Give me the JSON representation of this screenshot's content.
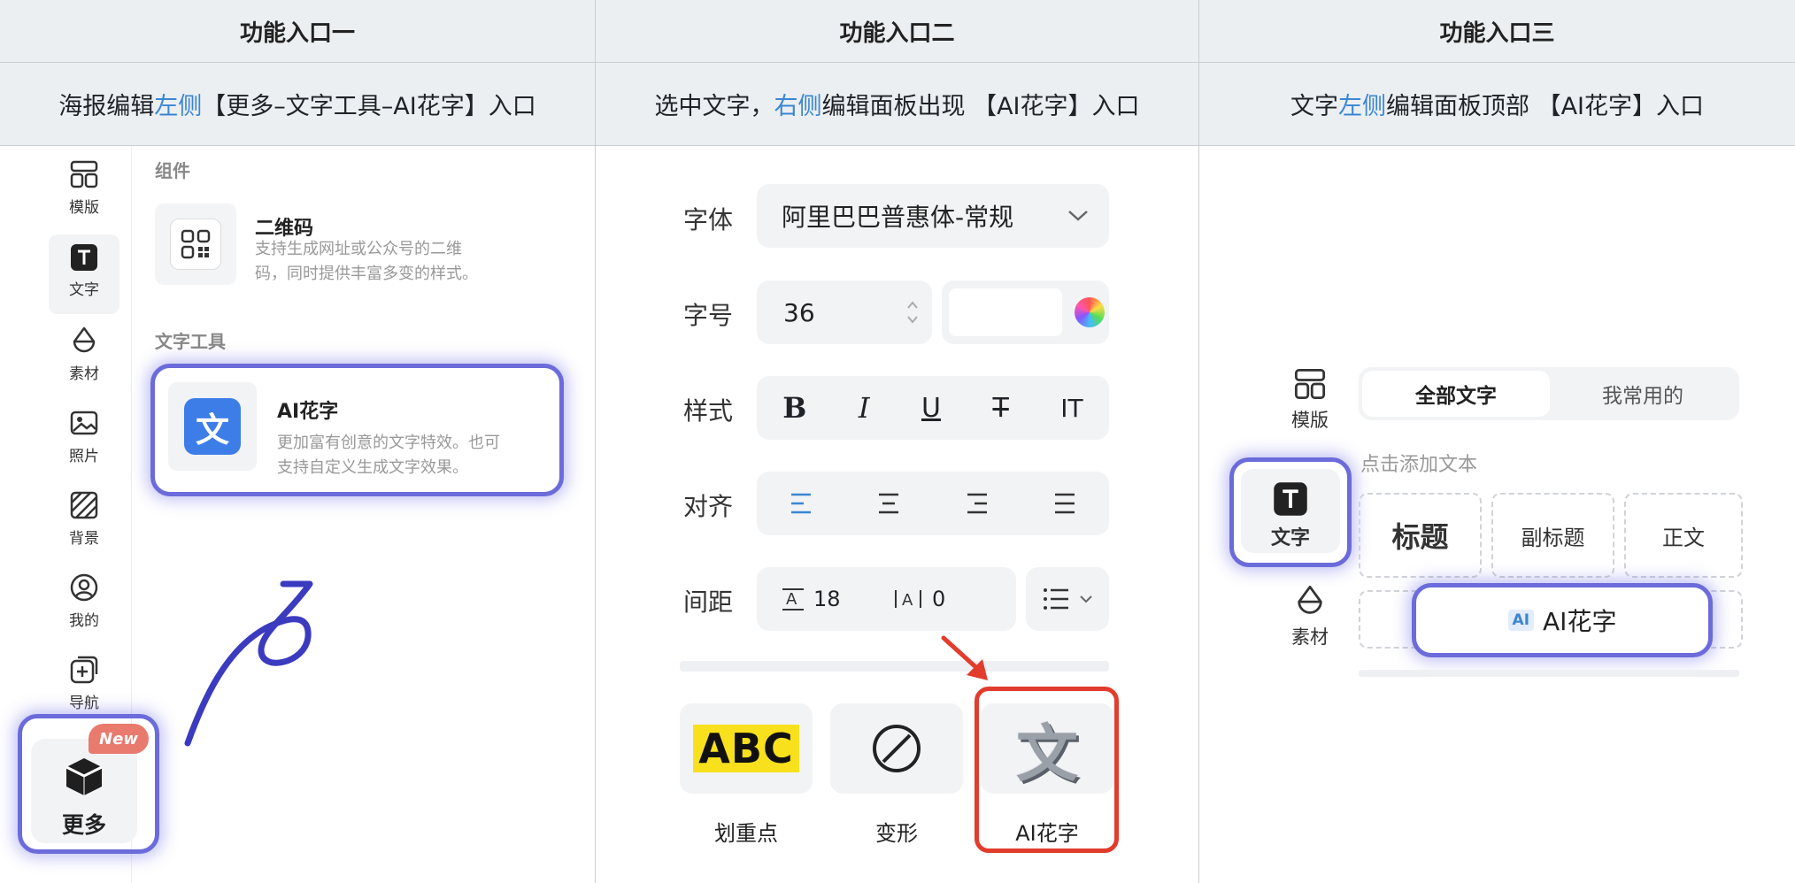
{
  "columns": [
    {
      "header": "功能入口一",
      "desc_pre": "海报编辑",
      "desc_hl": "左侧",
      "desc_post": " 【更多–文字工具–AI花字】入口"
    },
    {
      "header": "功能入口二",
      "desc_pre": "选中文字，",
      "desc_hl": "右侧",
      "desc_post": "编辑面板出现 【AI花字】入口"
    },
    {
      "header": "功能入口三",
      "desc_pre": "文字",
      "desc_hl": "左侧",
      "desc_post": "编辑面板顶部 【AI花字】入口"
    }
  ],
  "panel1": {
    "nav": [
      {
        "label": "模版",
        "icon": "template-icon"
      },
      {
        "label": "文字",
        "icon": "text-icon"
      },
      {
        "label": "素材",
        "icon": "material-icon"
      },
      {
        "label": "照片",
        "icon": "photo-icon"
      },
      {
        "label": "背景",
        "icon": "background-icon"
      },
      {
        "label": "我的",
        "icon": "user-icon"
      },
      {
        "label": "导航",
        "icon": "navigation-icon"
      }
    ],
    "section_components": "组件",
    "qr_title": "二维码",
    "qr_desc": "支持生成网址或公众号的二维码，同时提供丰富多变的样式。",
    "qr_desc_line1": "支持生成网址或公众号的二维",
    "qr_desc_line2": "码，同时提供丰富多变的样式。",
    "section_text_tools": "文字工具",
    "ai_title": "AI花字",
    "ai_desc_line1": "更加富有创意的文字特效。也可",
    "ai_desc_line2": "支持自定义生成文字效果。",
    "ai_tile_glyph": "文",
    "more_label": "更多",
    "new_badge": "New"
  },
  "panel2": {
    "font_label": "字体",
    "font_value": "阿里巴巴普惠体-常规",
    "size_label": "字号",
    "size_value": "36",
    "style_label": "样式",
    "style_buttons": [
      "B",
      "I",
      "U",
      "T",
      "IT"
    ],
    "align_label": "对齐",
    "spacing_label": "间距",
    "line_spacing": "18",
    "letter_spacing": "0",
    "effects": [
      {
        "label": "划重点",
        "preview": "ABC"
      },
      {
        "label": "变形",
        "preview": ""
      },
      {
        "label": "AI花字",
        "preview": "文"
      }
    ]
  },
  "panel3": {
    "nav": [
      {
        "label": "模版",
        "icon": "template-icon"
      },
      {
        "label": "文字",
        "icon": "text-icon"
      },
      {
        "label": "素材",
        "icon": "material-icon"
      }
    ],
    "tab_all": "全部文字",
    "tab_common": "我常用的",
    "hint": "点击添加文本",
    "title_btn": "标题",
    "subtitle_btn": "副标题",
    "body_btn": "正文",
    "ai_badge": "AI",
    "ai_label": "AI花字"
  },
  "colors": {
    "highlight_text": "#3a86d4",
    "highlight_border": "#6b6bdb",
    "red_frame": "#e23c2c"
  }
}
